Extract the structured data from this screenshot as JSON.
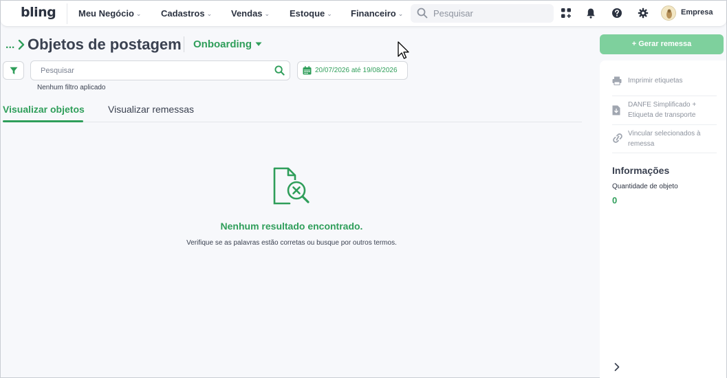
{
  "topbar": {
    "logo": "bling",
    "nav": [
      {
        "label": "Meu Negócio"
      },
      {
        "label": "Cadastros"
      },
      {
        "label": "Vendas"
      },
      {
        "label": "Estoque"
      },
      {
        "label": "Financeiro"
      }
    ],
    "search_placeholder": "Pesquisar",
    "company": "Empresa",
    "icons": [
      "apps-icon",
      "bell-icon",
      "help-icon",
      "gear-icon"
    ]
  },
  "header": {
    "breadcrumb": "...",
    "title": "Objetos de postagem",
    "context_dropdown": "Onboarding"
  },
  "filters": {
    "search_placeholder": "Pesquisar",
    "date_range": "20/07/2026 até 19/08/2026",
    "status": "Nenhum filtro aplicado"
  },
  "tabs": [
    {
      "label": "Visualizar objetos",
      "active": true
    },
    {
      "label": "Visualizar remessas",
      "active": false
    }
  ],
  "empty_state": {
    "title": "Nenhum resultado encontrado.",
    "subtitle": "Verifique se as palavras estão corretas ou busque por outros termos."
  },
  "sidebar": {
    "primary_button": "+ Gerar remessa",
    "actions": [
      {
        "label": "Imprimir etiquetas",
        "icon": "printer-icon"
      },
      {
        "label": "DANFE Simplificado + Etiqueta de transporte",
        "icon": "file-download-icon"
      },
      {
        "label": "Vincular selecionados à remessa",
        "icon": "link-icon"
      }
    ],
    "info_title": "Informações",
    "quantity_label": "Quantidade de objeto",
    "quantity_value": "0"
  },
  "colors": {
    "accent": "#2f9e5a",
    "accent_light": "#7ed09d",
    "text": "#3a4150",
    "muted": "#8d939e"
  }
}
